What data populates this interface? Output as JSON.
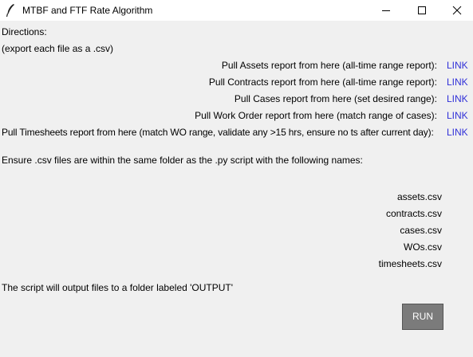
{
  "window": {
    "title": "MTBF and FTF Rate Algorithm"
  },
  "directions": {
    "heading": "Directions:",
    "subheading": "(export each file as a .csv)"
  },
  "reports": [
    {
      "text": "Pull Assets report from here (all-time range report):",
      "link": "LINK"
    },
    {
      "text": "Pull Contracts report from here (all-time range report):",
      "link": "LINK"
    },
    {
      "text": "Pull Cases report from here (set desired range):",
      "link": "LINK"
    },
    {
      "text": "Pull Work Order report from here (match range of cases):",
      "link": "LINK"
    },
    {
      "text": "Pull Timesheets report from here (match WO range, validate any >15 hrs, ensure no ts after current day):",
      "link": "LINK"
    }
  ],
  "instructions": "Ensure .csv files are within the same folder as the .py script with the following names:",
  "files": [
    "assets.csv",
    "contracts.csv",
    "cases.csv",
    "WOs.csv",
    "timesheets.csv"
  ],
  "output_note": "The script will output files to a folder labeled 'OUTPUT'",
  "run_button": "RUN",
  "colors": {
    "link": "#3030d8",
    "button_bg": "#7b7b7b",
    "background": "#f0f0f0"
  },
  "icons": {
    "app": "feather-icon",
    "minimize": "minimize-icon",
    "maximize": "maximize-icon",
    "close": "close-icon"
  }
}
